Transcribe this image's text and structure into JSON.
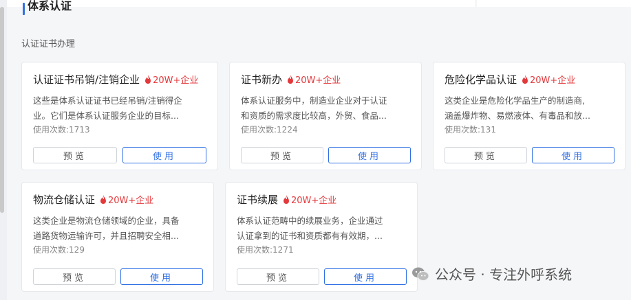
{
  "section": {
    "title": "体系认证"
  },
  "subtitle": "认证证书办理",
  "cards": [
    {
      "title": "认证证书吊销/注销企业",
      "badge": "20W+企业",
      "desc_line1": "这些是体系认证证书已经吊销/注销得企",
      "desc_line2": "业。它们是体系认证服务企业的目标...",
      "usage": "使用次数:1713",
      "preview_label": "预览",
      "use_label": "使用"
    },
    {
      "title": "证书新办",
      "badge": "20W+企业",
      "desc_line1": "体系认证服务中，制造业企业对于认证",
      "desc_line2": "和资质的需求度比较高，外贸、食品...",
      "usage": "使用次数:1224",
      "preview_label": "预览",
      "use_label": "使用"
    },
    {
      "title": "危险化学品认证",
      "badge": "20W+企业",
      "desc_line1": "这类企业是危险化学品生产的制造商,",
      "desc_line2": "涵盖爆炸物、易燃液体、有毒品和放...",
      "usage": "使用次数:131",
      "preview_label": "预览",
      "use_label": "使用"
    },
    {
      "title": "物流仓储认证",
      "badge": "20W+企业",
      "desc_line1": "这类企业是物流仓储领域的企业，具备",
      "desc_line2": "道路货物运输许可，并且招聘安全相...",
      "usage": "使用次数:129",
      "preview_label": "预览",
      "use_label": "使用"
    },
    {
      "title": "证书续展",
      "badge": "20W+企业",
      "desc_line1": "体系认证范畴中的续展业务，企业通过",
      "desc_line2": "认证拿到的证书和资质都有有效期，...",
      "usage": "使用次数:1271",
      "preview_label": "预览",
      "use_label": "使用"
    }
  ],
  "watermark": {
    "text": "公众号 · 专注外呼系统"
  },
  "colors": {
    "accent": "#2f6fe4",
    "badge": "#e4393c"
  },
  "icons": {
    "badge_icon": "fire-icon",
    "watermark_icon": "wechat-icon"
  }
}
